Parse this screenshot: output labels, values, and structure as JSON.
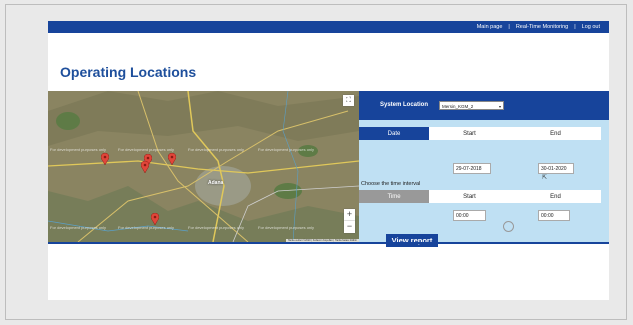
{
  "nav": {
    "main_page": "Main page",
    "sep1": "|",
    "realtime": "Real-Time Monitoring",
    "sep2": "|",
    "logout": "Log out"
  },
  "page_title": "Operating Locations",
  "map": {
    "city_label": "Adana",
    "dev_text": "For development purposes only",
    "attribution": "Harita verileri ©2020 | Kullanım Koşulları | Harita hatası bildirin",
    "zoom_in": "+",
    "zoom_out": "−",
    "fullscreen_icon": "expand-icon",
    "marker_color": "#e0463a"
  },
  "panel": {
    "system_location_label": "System Location",
    "system_location_value": "Mersin_KGM_2",
    "date_header": {
      "col1": "Date",
      "col2": "Start",
      "col3": "End"
    },
    "start_date": "29-07-2018",
    "end_date": "30-01-2020",
    "interval_label": "Choose the time interval",
    "time_header": {
      "col1": "Time",
      "col2": "Start",
      "col3": "End"
    },
    "start_time": "00:00",
    "end_time": "00:00",
    "view_report": "View report"
  },
  "colors": {
    "brand_blue": "#17449b",
    "title_blue": "#1e4f9c",
    "panel_bg": "#bfe0f3"
  }
}
